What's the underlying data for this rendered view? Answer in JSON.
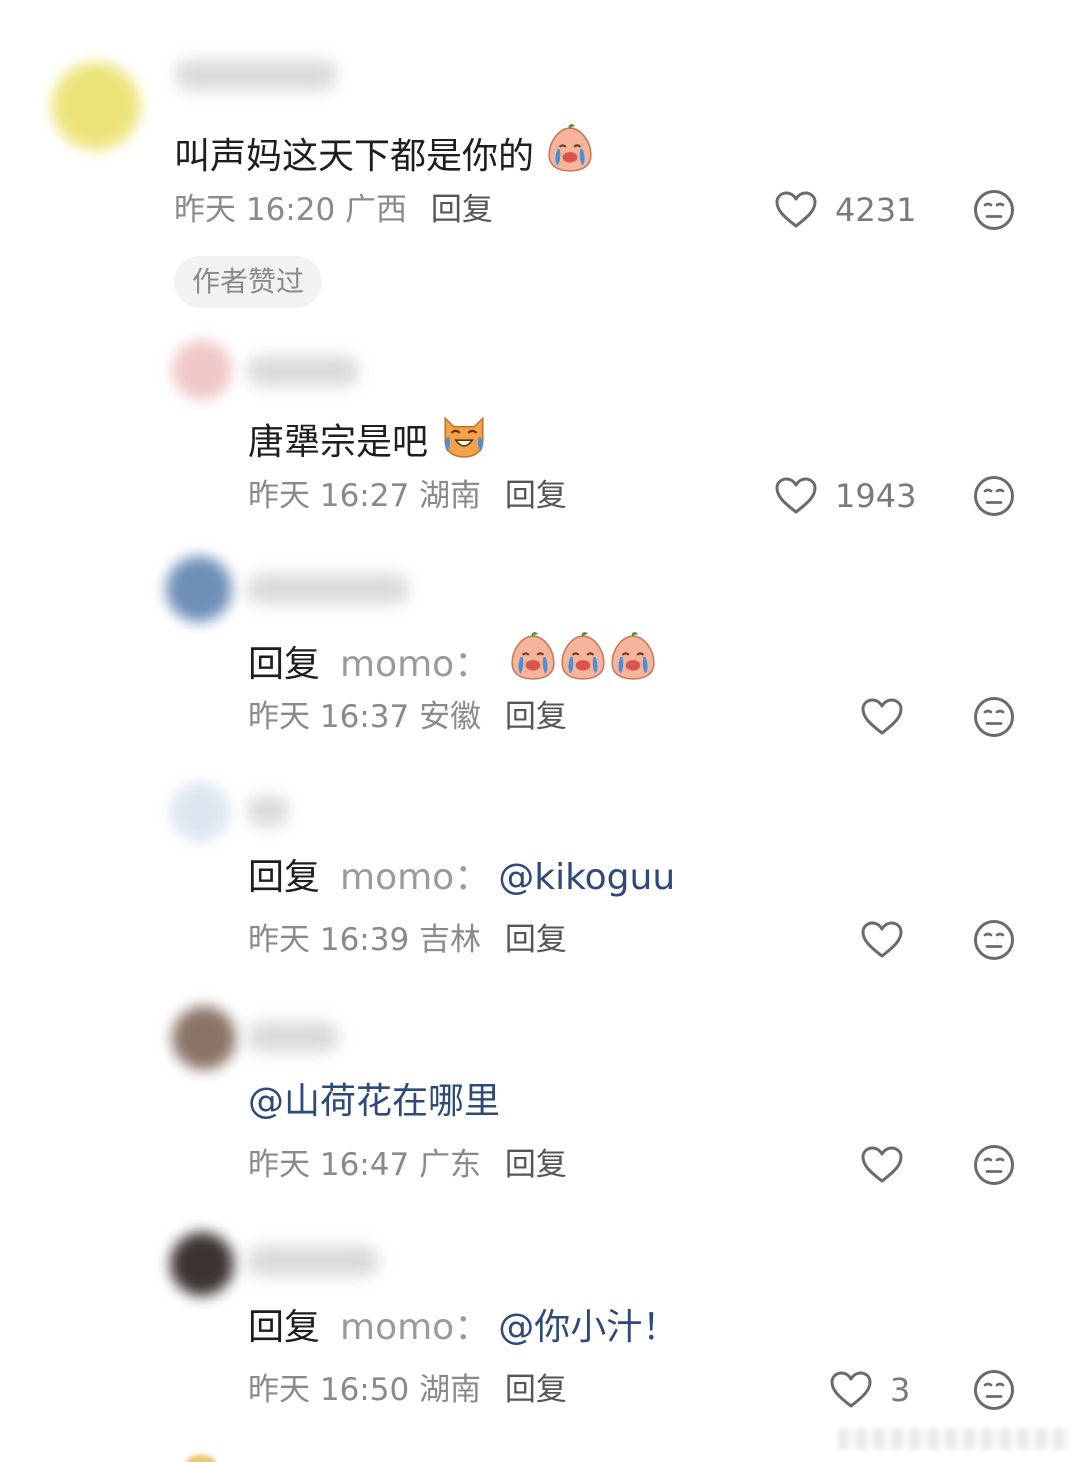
{
  "comments": [
    {
      "text": "叫声妈这天下都是你的",
      "time": "昨天 16:20",
      "location": "广西",
      "reply_label": "回复",
      "likes": "4231",
      "badge": "作者赞过"
    },
    {
      "text": "唐犟宗是吧",
      "time": "昨天 16:27",
      "location": "湖南",
      "reply_label": "回复",
      "likes": "1943"
    },
    {
      "reply_prefix": "回复",
      "reply_target": "momo：",
      "time": "昨天 16:37",
      "location": "安徽",
      "reply_label": "回复"
    },
    {
      "reply_prefix": "回复",
      "reply_target": "momo：",
      "mention": "@kikoguu",
      "time": "昨天 16:39",
      "location": "吉林",
      "reply_label": "回复"
    },
    {
      "mention": "@山荷花在哪里",
      "time": "昨天 16:47",
      "location": "广东",
      "reply_label": "回复"
    },
    {
      "reply_prefix": "回复",
      "reply_target": "momo：",
      "mention": "@你小汁！",
      "time": "昨天 16:50",
      "location": "湖南",
      "reply_label": "回复",
      "likes": "3"
    }
  ],
  "icons": {
    "like": "heart-outline-icon",
    "dislike": "meh-face-icon",
    "emoji_cry_peach": "crying-peach-emoji",
    "emoji_cat": "laughing-cat-emoji"
  },
  "colors": {
    "text": "#1e1e1e",
    "meta": "#8a8a8a",
    "mention": "#2e4a7a",
    "badge_bg": "#f2f2f2"
  }
}
